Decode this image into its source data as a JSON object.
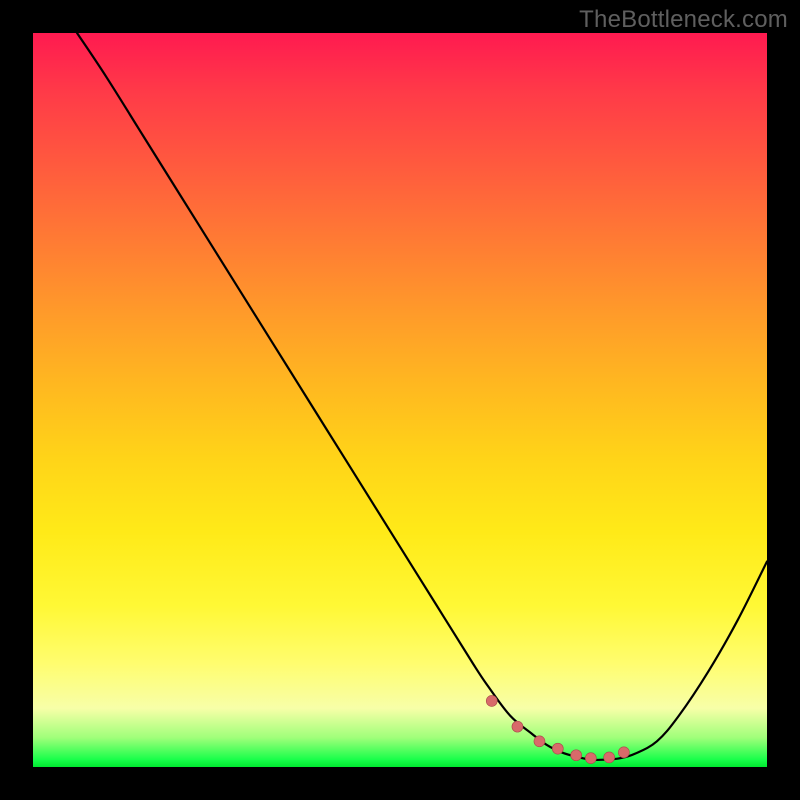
{
  "watermark": "TheBottleneck.com",
  "chart_data": {
    "type": "line",
    "title": "",
    "xlabel": "",
    "ylabel": "",
    "xlim": [
      0,
      100
    ],
    "ylim": [
      0,
      100
    ],
    "grid": false,
    "series": [
      {
        "name": "curve",
        "x": [
          6,
          10,
          15,
          20,
          25,
          30,
          35,
          40,
          45,
          50,
          55,
          60,
          62,
          65,
          68,
          70,
          72,
          74,
          76,
          78,
          80,
          82,
          85,
          88,
          92,
          96,
          100
        ],
        "y": [
          100,
          94,
          86,
          78,
          70,
          62,
          54,
          46,
          38,
          30,
          22,
          14,
          11,
          7,
          4.5,
          3,
          2,
          1.4,
          1,
          1,
          1.2,
          1.8,
          3.5,
          7,
          13,
          20,
          28
        ]
      }
    ],
    "markers": {
      "name": "dots",
      "x": [
        62.5,
        66,
        69,
        71.5,
        74,
        76,
        78.5,
        80.5
      ],
      "y": [
        9,
        5.5,
        3.5,
        2.5,
        1.6,
        1.2,
        1.3,
        2
      ]
    },
    "colors": {
      "curve": "#000000",
      "marker_fill": "#d86a6a",
      "marker_stroke": "#a94a4a",
      "gradient_top": "#ff1a50",
      "gradient_bottom": "#00e830"
    }
  }
}
